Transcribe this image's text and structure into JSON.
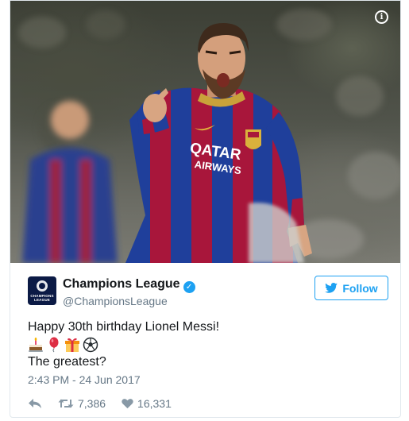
{
  "tweet": {
    "author_name": "Champions League",
    "author_handle": "@ChampionsLeague",
    "avatar_text": "CHAMPIONS LEAGUE",
    "follow_label": "Follow",
    "text_line1": "Happy 30th birthday Lionel Messi!",
    "emojis": [
      "birthday-cake",
      "balloon",
      "wrapped-gift",
      "soccer-ball"
    ],
    "text_line3": "The greatest?",
    "timestamp": "2:43 PM - 24 Jun 2017",
    "retweet_count": "7,386",
    "like_count": "16,331",
    "photo": {
      "jersey_text_1": "QATAR",
      "jersey_text_2": "AIRWAYS",
      "alt_hint": "footballer celebrating"
    }
  },
  "colors": {
    "twitter_blue": "#1da1f2",
    "text_primary": "#14171a",
    "text_secondary": "#657786",
    "jersey_blue": "#1f3f9b",
    "jersey_red": "#a8163b"
  },
  "icons": [
    "info-icon",
    "verified-icon",
    "twitter-bird-icon",
    "reply-icon",
    "retweet-icon",
    "heart-icon"
  ]
}
